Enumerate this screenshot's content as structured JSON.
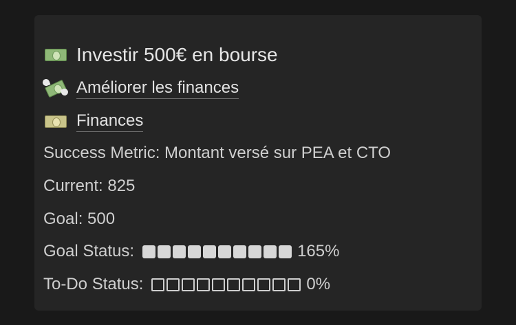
{
  "card": {
    "title": "Investir 500€ en bourse",
    "title_icon": "euro-banknote-icon",
    "links": [
      {
        "label": "Améliorer les finances",
        "icon": "money-with-wings-icon"
      },
      {
        "label": "Finances",
        "icon": "dollar-banknote-icon"
      }
    ],
    "success_metric": "Success Metric: Montant versé sur PEA et CTO",
    "current": "Current: 825",
    "goal": "Goal: 500",
    "goal_status": {
      "label": "Goal Status:",
      "filled_blocks": 10,
      "total_blocks": 10,
      "percent_text": "165%"
    },
    "todo_status": {
      "label": "To-Do Status:",
      "filled_blocks": 0,
      "total_blocks": 10,
      "percent_text": "0%"
    }
  },
  "colors": {
    "page_background": "#191919",
    "card_background": "#252525",
    "text": "#d4d4d4"
  }
}
